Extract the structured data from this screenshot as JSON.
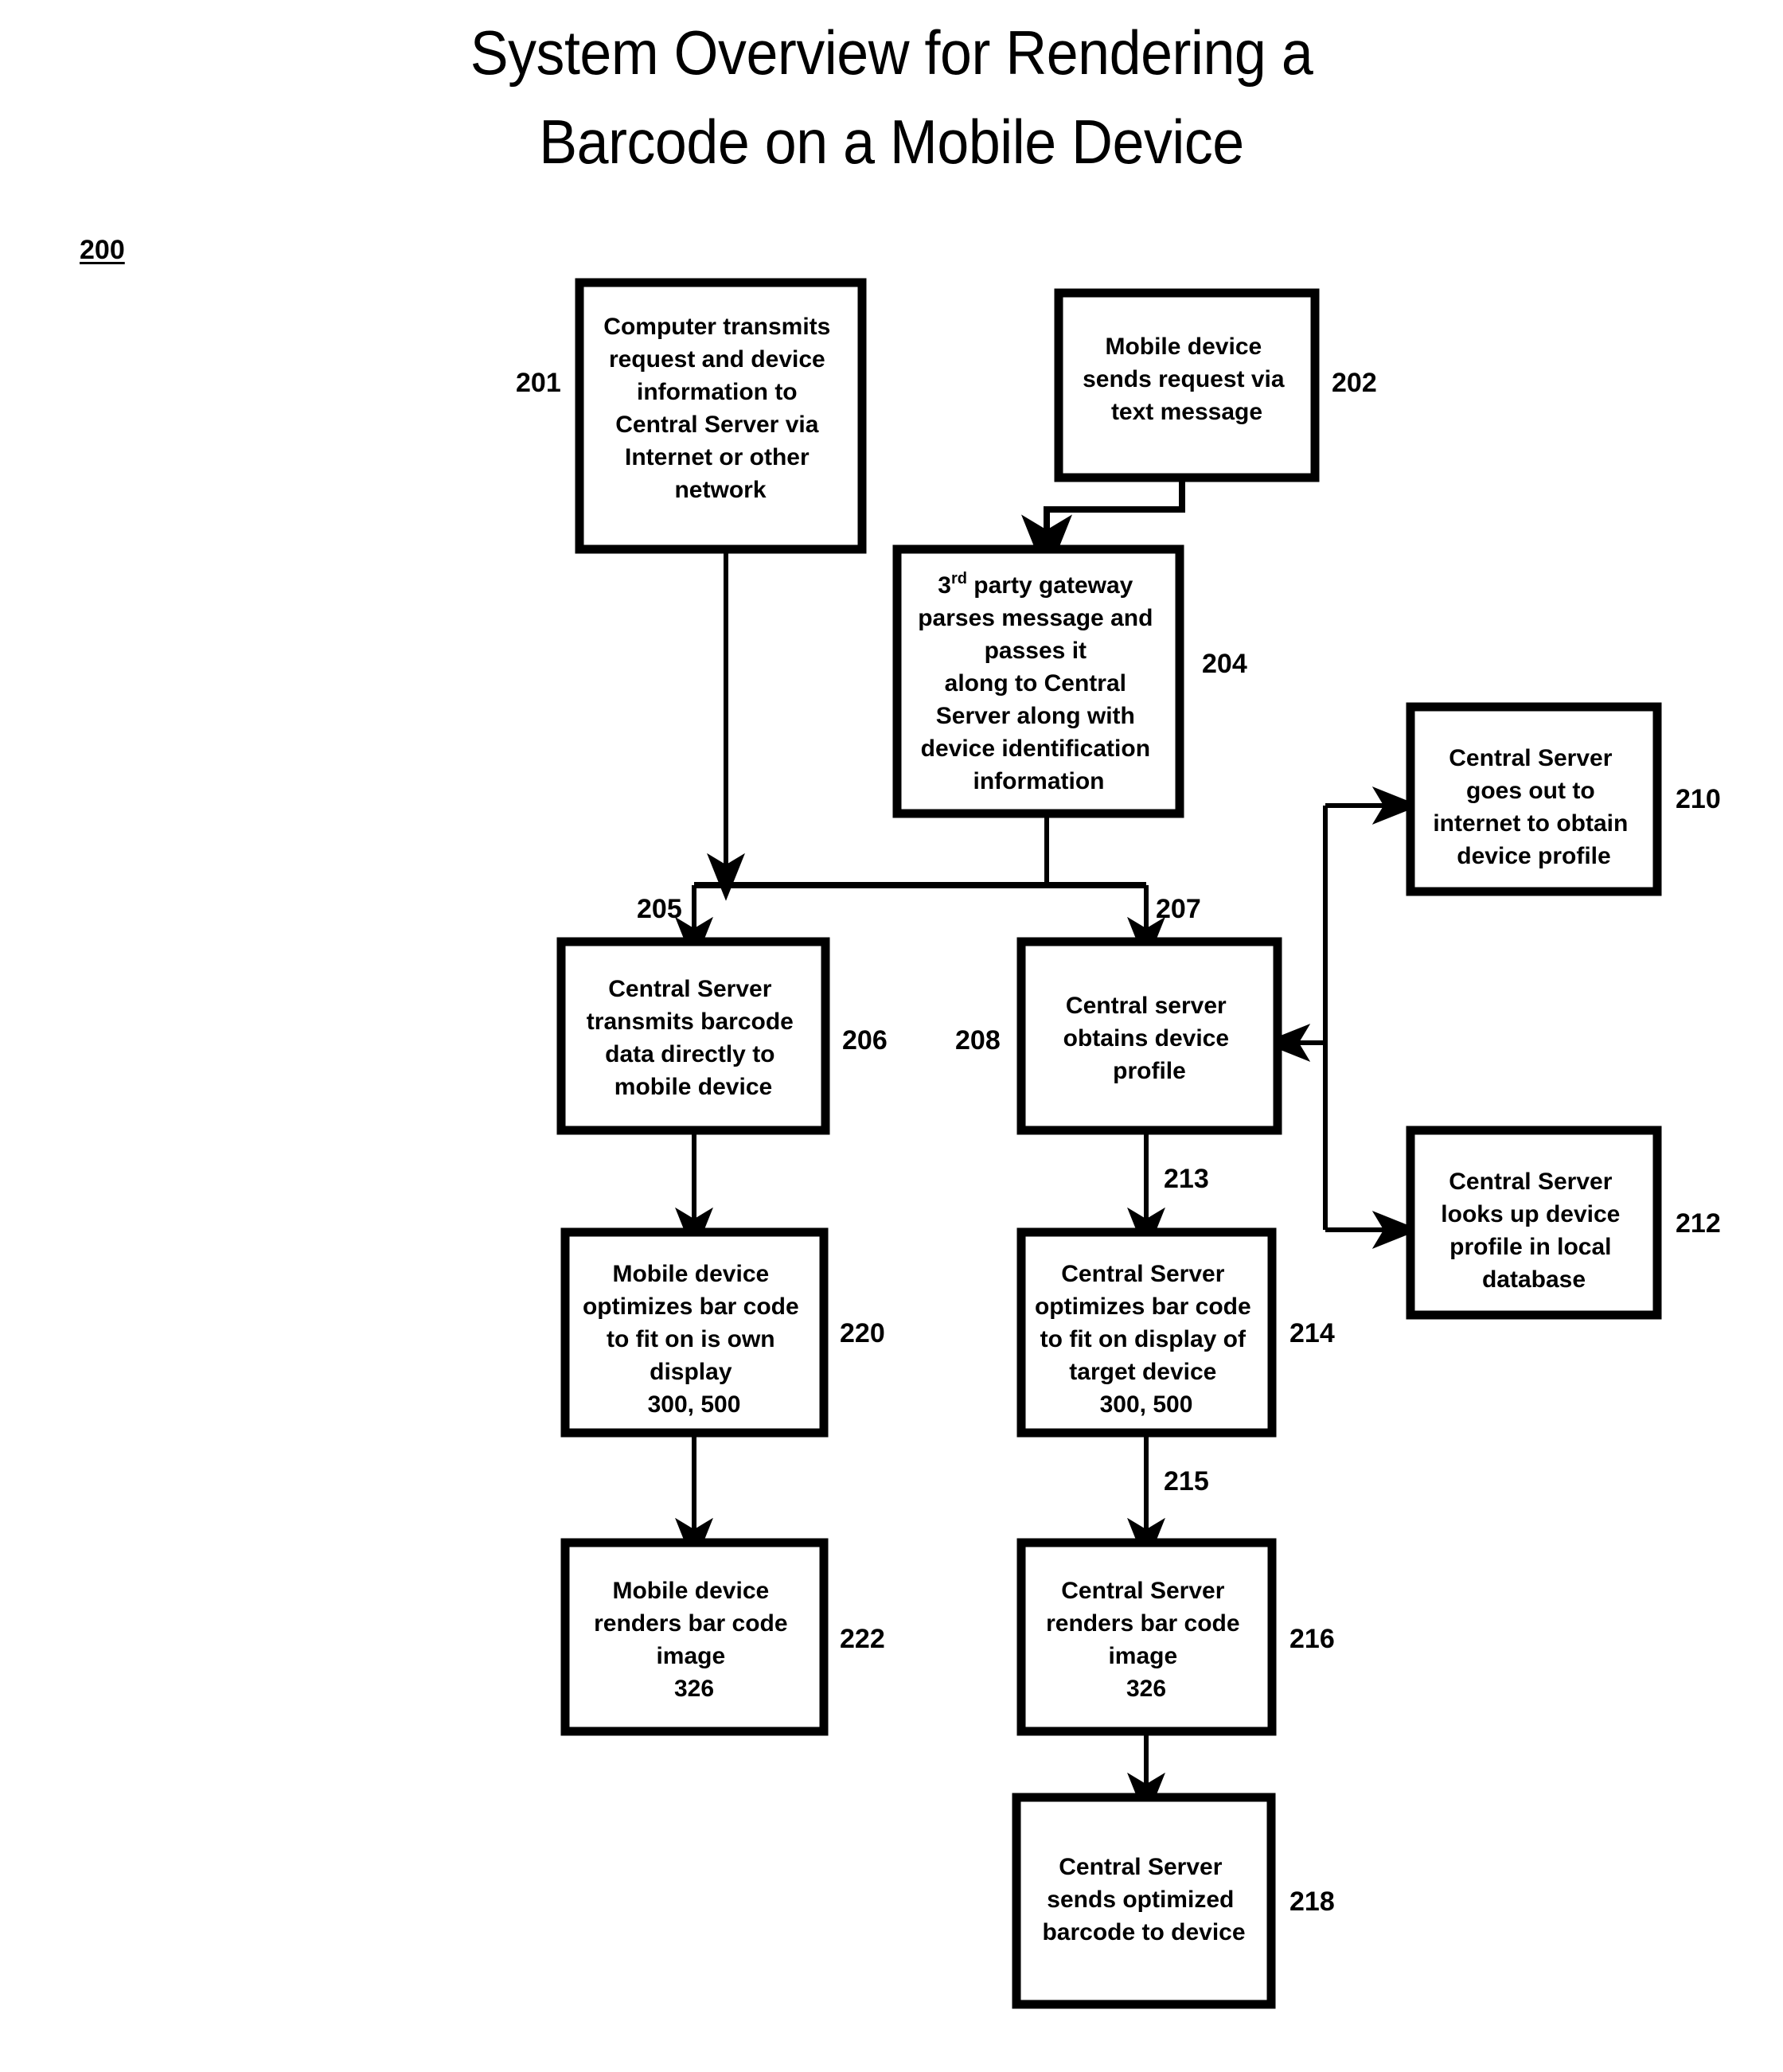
{
  "figure": {
    "title": "System Overview for Rendering a\nBarcode on a Mobile Device",
    "figure_number": "200"
  },
  "boxes": {
    "b201": {
      "ref": "201",
      "text": "Computer transmits\nrequest and device\ninformation to\nCentral Server via\nInternet or other\nnetwork"
    },
    "b202": {
      "ref": "202",
      "text": "Mobile device\nsends request via\ntext message"
    },
    "b204": {
      "ref": "204",
      "text_line1_prefix": "3",
      "text_line1_sup": "rd",
      "text_line1_suffix": " party gateway",
      "text": "parses message and\npasses it\nalong to Central\nServer along with\ndevice identification\ninformation"
    },
    "b210": {
      "ref": "210",
      "text": "Central Server\ngoes out to\ninternet to obtain\ndevice profile"
    },
    "b212": {
      "ref": "212",
      "text": "Central Server\nlooks up device\nprofile in local\ndatabase"
    },
    "b206": {
      "ref": "206",
      "text": "Central Server\ntransmits barcode\ndata directly to\nmobile device"
    },
    "b208": {
      "ref": "208",
      "text": "Central server\nobtains device\nprofile"
    },
    "b220": {
      "ref": "220",
      "text": "Mobile device\noptimizes bar code\nto fit on is own\ndisplay\n300, 500"
    },
    "b214": {
      "ref": "214",
      "text": "Central Server\noptimizes bar code\nto fit on display of\ntarget device\n300, 500"
    },
    "b222": {
      "ref": "222",
      "text": "Mobile device\nrenders bar code\nimage\n326"
    },
    "b216": {
      "ref": "216",
      "text": "Central Server\nrenders bar code\nimage\n326"
    },
    "b218": {
      "ref": "218",
      "text": "Central Server\nsends optimized\nbarcode to device"
    }
  },
  "edge_labels": {
    "e205": "205",
    "e207": "207",
    "e213": "213",
    "e215": "215"
  },
  "colors": {
    "ink": "#000000",
    "paper": "#ffffff"
  }
}
